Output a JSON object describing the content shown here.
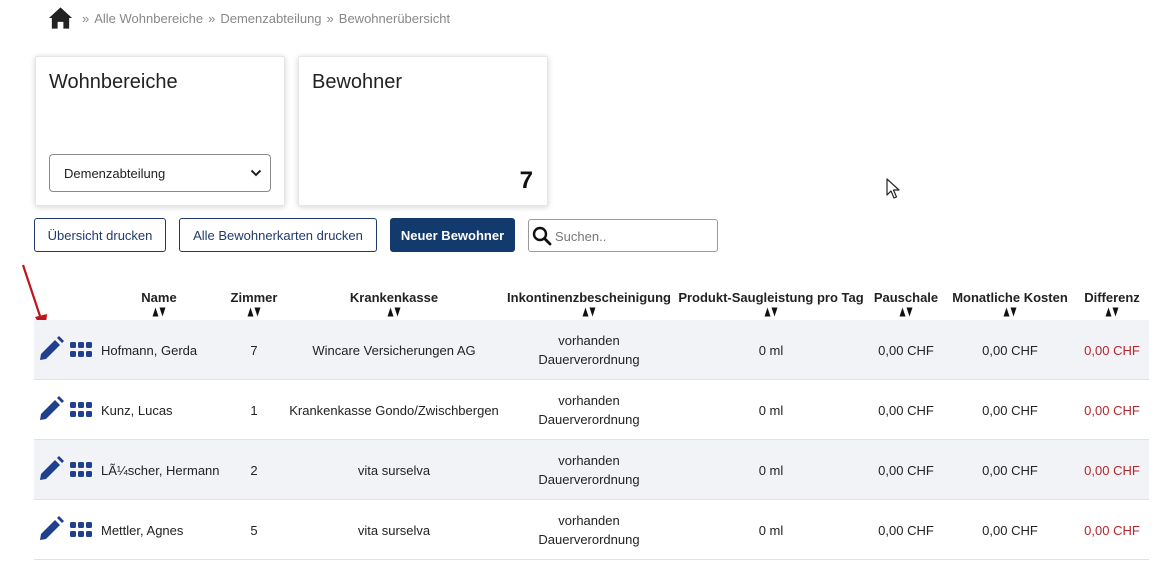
{
  "breadcrumb": {
    "items": [
      "Alle Wohnbereiche",
      "Demenzabteilung",
      "Bewohnerübersicht"
    ],
    "separator": "»"
  },
  "cards": {
    "wohnbereiche": {
      "title": "Wohnbereiche",
      "selected": "Demenzabteilung"
    },
    "bewohner": {
      "title": "Bewohner",
      "count": "7"
    }
  },
  "toolbar": {
    "print_overview": "Übersicht drucken",
    "print_cards": "Alle Bewohnerkarten drucken",
    "new_resident": "Neuer Bewohner",
    "search_placeholder": "Suchen.."
  },
  "table": {
    "columns": [
      "Name",
      "Zimmer",
      "Krankenkasse",
      "Inkontinenzbescheinigung",
      "Produkt-Saugleistung pro Tag",
      "Pauschale",
      "Monatliche Kosten",
      "Differenz"
    ],
    "rows": [
      {
        "name": "Hofmann, Gerda",
        "zimmer": "7",
        "krankenkasse": "Wincare Versicherungen AG",
        "bescheinigung_1": "vorhanden",
        "bescheinigung_2": "Dauerverordnung",
        "saugleistung": "0 ml",
        "pauschale": "0,00 CHF",
        "kosten": "0,00 CHF",
        "differenz": "0,00 CHF"
      },
      {
        "name": "Kunz, Lucas",
        "zimmer": "1",
        "krankenkasse": "Krankenkasse Gondo/Zwischbergen",
        "bescheinigung_1": "vorhanden",
        "bescheinigung_2": "Dauerverordnung",
        "saugleistung": "0 ml",
        "pauschale": "0,00 CHF",
        "kosten": "0,00 CHF",
        "differenz": "0,00 CHF"
      },
      {
        "name": "LÃ¼scher, Hermann",
        "zimmer": "2",
        "krankenkasse": "vita surselva",
        "bescheinigung_1": "vorhanden",
        "bescheinigung_2": "Dauerverordnung",
        "saugleistung": "0 ml",
        "pauschale": "0,00 CHF",
        "kosten": "0,00 CHF",
        "differenz": "0,00 CHF"
      },
      {
        "name": "Mettler, Agnes",
        "zimmer": "5",
        "krankenkasse": "vita surselva",
        "bescheinigung_1": "vorhanden",
        "bescheinigung_2": "Dauerverordnung",
        "saugleistung": "0 ml",
        "pauschale": "0,00 CHF",
        "kosten": "0,00 CHF",
        "differenz": "0,00 CHF"
      }
    ]
  },
  "colors": {
    "primary": "#133a6d",
    "icon": "#1f3f8f",
    "negative": "#b0282e",
    "annotation": "#c0141c"
  }
}
